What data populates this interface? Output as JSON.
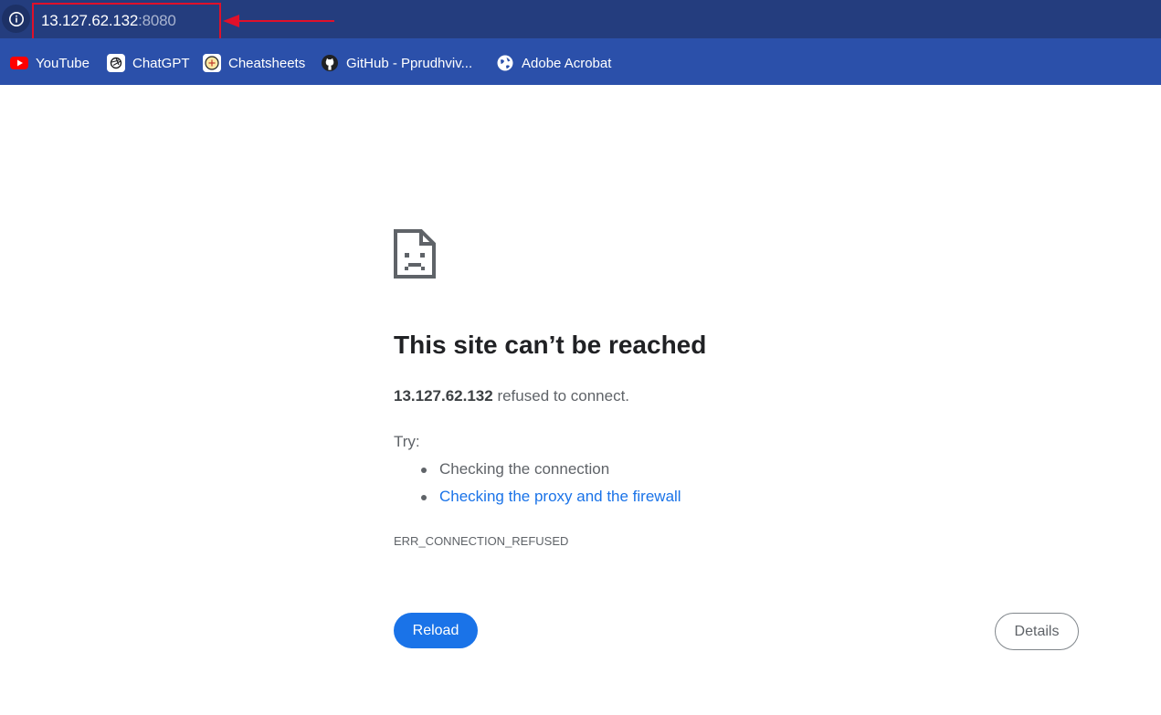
{
  "address_bar": {
    "host": "13.127.62.132",
    "port": ":8080",
    "highlight_color": "#e0102a"
  },
  "bookmarks": [
    {
      "label": "YouTube",
      "icon": "youtube-icon"
    },
    {
      "label": "ChatGPT",
      "icon": "chatgpt-icon"
    },
    {
      "label": "Cheatsheets",
      "icon": "cheatsheets-icon"
    },
    {
      "label": "GitHub - Pprudhviv...",
      "icon": "github-icon"
    },
    {
      "label": "Adobe Acrobat",
      "icon": "globe-icon"
    }
  ],
  "error": {
    "title": "This site can’t be reached",
    "host": "13.127.62.132",
    "message": " refused to connect.",
    "try_label": "Try:",
    "suggestions": [
      "Checking the connection",
      "Checking the proxy and the firewall"
    ],
    "code": "ERR_CONNECTION_REFUSED"
  },
  "buttons": {
    "reload": "Reload",
    "details": "Details"
  },
  "colors": {
    "address_bar_bg": "#243d7e",
    "bookmarks_bg": "#2b50aa",
    "link": "#1a73e8",
    "primary_button": "#1a73e8"
  }
}
